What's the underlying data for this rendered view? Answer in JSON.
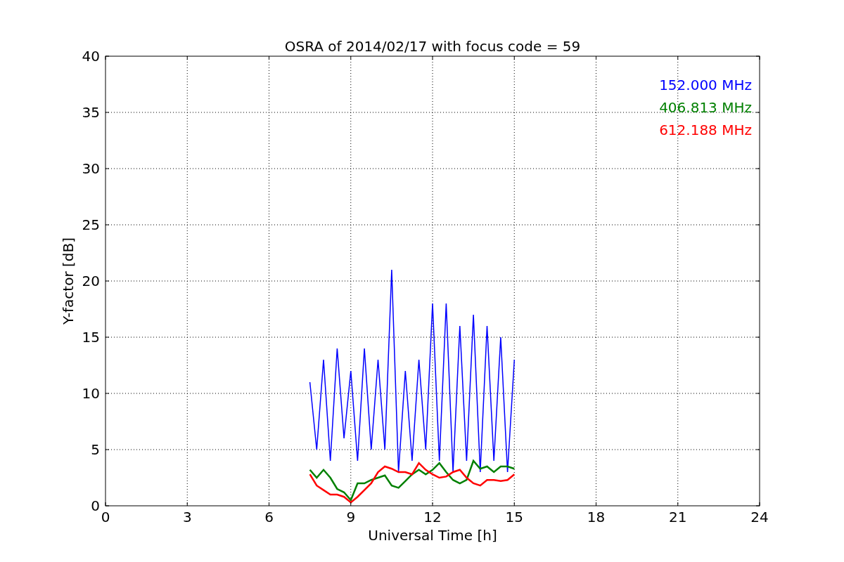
{
  "figure": {
    "chart_data": {
      "type": "line",
      "grid": true,
      "title": "OSRA of 2014/02/17 with focus code = 59",
      "xlabel": "Universal Time [h]",
      "ylabel": "Y-factor [dB]",
      "xlim": [
        0,
        24
      ],
      "ylim": [
        0,
        40
      ],
      "xticks": [
        0,
        3,
        6,
        9,
        12,
        15,
        18,
        21,
        24
      ],
      "yticks": [
        0,
        5,
        10,
        15,
        20,
        25,
        30,
        35,
        40
      ],
      "x": [
        7.5,
        7.75,
        8.0,
        8.25,
        8.5,
        8.75,
        9.0,
        9.25,
        9.5,
        9.75,
        10.0,
        10.25,
        10.5,
        10.75,
        11.0,
        11.25,
        11.5,
        11.75,
        12.0,
        12.25,
        12.5,
        12.75,
        13.0,
        13.25,
        13.5,
        13.75,
        14.0,
        14.25,
        14.5,
        14.75,
        15.0
      ],
      "series": [
        {
          "name": "152.000 MHz",
          "color": "#0000ff",
          "values": [
            11,
            5,
            13,
            4,
            14,
            6,
            12,
            4,
            14,
            5,
            13,
            5,
            21,
            3,
            12,
            4,
            13,
            5,
            18,
            4,
            18,
            3,
            16,
            4,
            17,
            3,
            16,
            4,
            15,
            3,
            13
          ]
        },
        {
          "name": "406.813 MHz",
          "color": "#008000",
          "values": [
            3.2,
            2.5,
            3.2,
            2.5,
            1.5,
            1.2,
            0.5,
            2.0,
            2.0,
            2.3,
            2.5,
            2.7,
            1.8,
            1.6,
            2.2,
            2.8,
            3.2,
            2.8,
            3.2,
            3.8,
            3.0,
            2.3,
            2.0,
            2.3,
            4.0,
            3.3,
            3.5,
            3.0,
            3.5,
            3.5,
            3.3
          ]
        },
        {
          "name": "612.188 MHz",
          "color": "#ff0000",
          "values": [
            2.8,
            1.8,
            1.4,
            1.0,
            1.0,
            0.8,
            0.3,
            0.8,
            1.4,
            2.0,
            3.0,
            3.5,
            3.3,
            3.0,
            3.0,
            2.8,
            3.8,
            3.2,
            2.8,
            2.5,
            2.6,
            3.0,
            3.2,
            2.5,
            2.0,
            1.8,
            2.3,
            2.3,
            2.2,
            2.3,
            2.8
          ]
        }
      ]
    }
  }
}
